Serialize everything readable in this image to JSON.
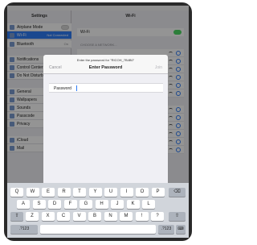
{
  "sidebar": {
    "title": "Settings",
    "items": [
      {
        "label": "Airplane Mode",
        "value": "",
        "toggle": true,
        "on": false
      },
      {
        "label": "Wi-Fi",
        "value": "Not Connected",
        "selected": true
      },
      {
        "label": "Bluetooth",
        "value": "On"
      },
      {
        "label": "Notifications",
        "value": ""
      },
      {
        "label": "Control Center",
        "value": ""
      },
      {
        "label": "Do Not Disturb",
        "value": ""
      },
      {
        "label": "General",
        "value": ""
      },
      {
        "label": "Wallpapers",
        "value": ""
      },
      {
        "label": "Sounds",
        "value": ""
      },
      {
        "label": "Passcode",
        "value": ""
      },
      {
        "label": "Privacy",
        "value": ""
      },
      {
        "label": "iCloud",
        "value": ""
      },
      {
        "label": "Mail",
        "value": ""
      }
    ]
  },
  "detail": {
    "title": "Wi-Fi",
    "wifi_label": "Wi-Fi",
    "network_header": "CHOOSE A NETWORK..."
  },
  "dialog": {
    "hint": "Enter the password for \"RICOH_7B4B0\"",
    "cancel": "Cancel",
    "title": "Enter Password",
    "join": "Join",
    "password_label": "Password",
    "password_value": ""
  },
  "keyboard": {
    "row1": [
      "Q",
      "W",
      "E",
      "R",
      "T",
      "Y",
      "U",
      "I",
      "O",
      "P"
    ],
    "row2": [
      "A",
      "S",
      "D",
      "F",
      "G",
      "H",
      "J",
      "K",
      "L"
    ],
    "row3": [
      "Z",
      "X",
      "C",
      "V",
      "B",
      "N",
      "M",
      "!",
      "?"
    ],
    "shift": "⇧",
    "backspace": "⌫",
    "numbers_left": ".?123",
    "numbers_right": ".?123",
    "keyboard_key": "⌨"
  },
  "colors": {
    "accent": "#2f7cf6",
    "toggle_on": "#4cd964"
  }
}
